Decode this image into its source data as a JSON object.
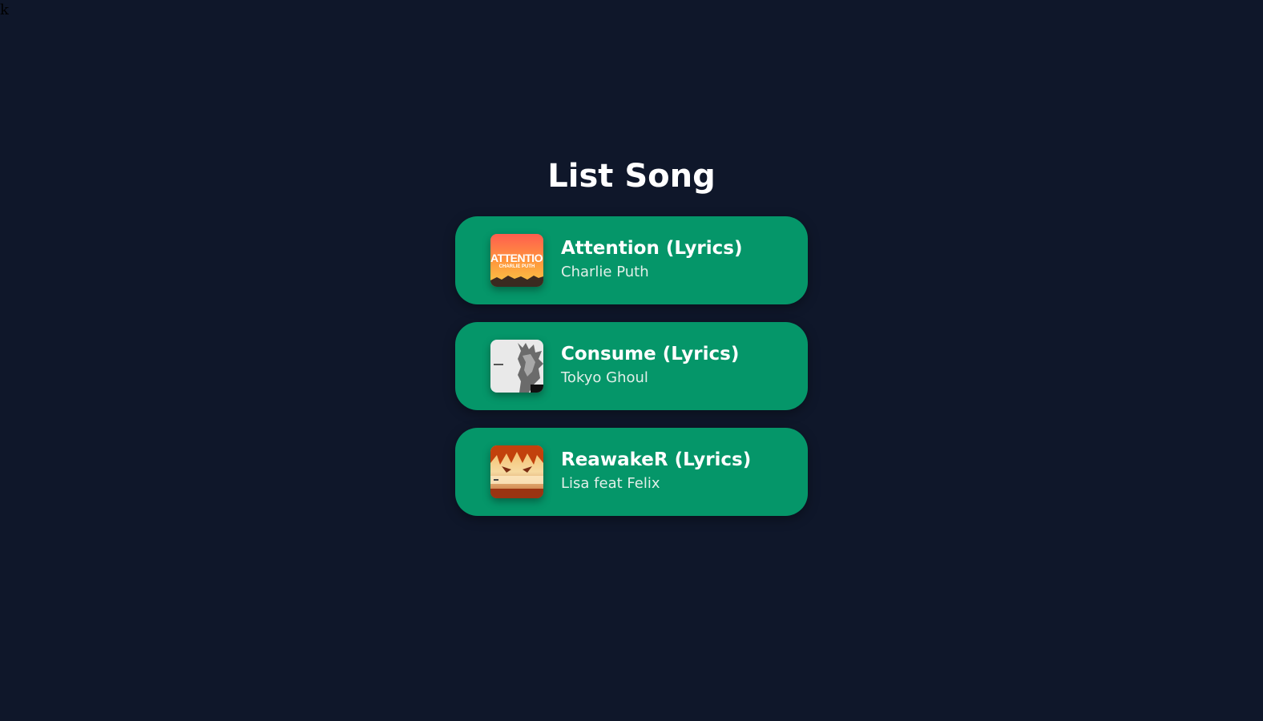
{
  "stray_text": "k",
  "page": {
    "title": "List Song",
    "background": "#0f172a"
  },
  "songs": [
    {
      "title": "Attention (Lyrics)",
      "artist": "Charlie Puth",
      "card_color": "#059669",
      "cover": {
        "title_text": "ATTENTION",
        "subtitle_text": "CHARLIE PUTH"
      }
    },
    {
      "title": "Consume (Lyrics)",
      "artist": "Tokyo Ghoul",
      "card_color": "#059669"
    },
    {
      "title": "ReawakeR (Lyrics)",
      "artist": "Lisa feat Felix",
      "card_color": "#059669"
    }
  ]
}
